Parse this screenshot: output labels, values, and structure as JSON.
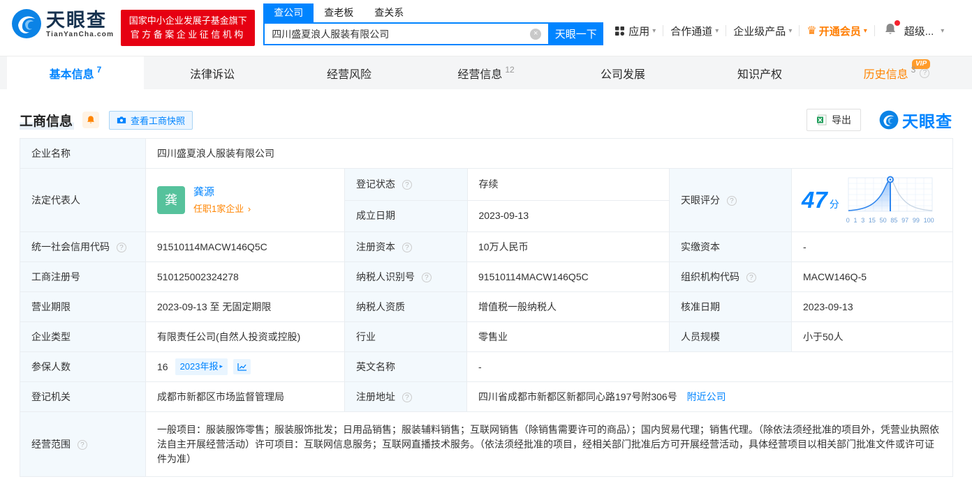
{
  "colors": {
    "primary_blue": "#0084ff",
    "orange": "#ff7d00",
    "status_green": "#2db14e",
    "avatar_green": "#56c29c",
    "badge_red": "#e60012"
  },
  "icons": {
    "help": "?",
    "clear": "×",
    "dropdown_arrow": "▾",
    "arrow_right": "›",
    "crown": "♛",
    "play": "▸"
  },
  "header": {
    "logo_text": "天眼查",
    "logo_domain": "TianYanCha.com",
    "badge_line1": "国家中小企业发展子基金旗下",
    "badge_line2": "官方备案企业征信机构",
    "search_tab_company": "查公司",
    "search_tab_boss": "查老板",
    "search_tab_relation": "查关系",
    "search_value": "四川盛夏浪人服装有限公司",
    "search_button": "天眼一下",
    "nav_apps": "应用",
    "nav_coop": "合作通道",
    "nav_enterprise": "企业级产品",
    "nav_vip": "开通会员",
    "nav_user": "超级..."
  },
  "tabs": {
    "basic": {
      "label": "基本信息",
      "count": "7"
    },
    "legal": {
      "label": "法律诉讼"
    },
    "risk": {
      "label": "经营风险"
    },
    "business": {
      "label": "经营信息",
      "count": "12"
    },
    "development": {
      "label": "公司发展"
    },
    "ip": {
      "label": "知识产权"
    },
    "history": {
      "label": "历史信息",
      "count": "3",
      "vip": "VIP"
    }
  },
  "section": {
    "title": "工商信息",
    "snapshot_button": "查看工商快照",
    "export_button": "导出",
    "brand": "天眼查"
  },
  "info": {
    "labels": {
      "company_name": "企业名称",
      "legal_rep": "法定代表人",
      "reg_status": "登记状态",
      "establish_date": "成立日期",
      "score": "天眼评分",
      "credit_code": "统一社会信用代码",
      "reg_capital": "注册资本",
      "paid_capital": "实缴资本",
      "reg_number": "工商注册号",
      "taxpayer_id": "纳税人识别号",
      "org_code": "组织机构代码",
      "business_term": "营业期限",
      "taxpayer_quality": "纳税人资质",
      "approval_date": "核准日期",
      "company_type": "企业类型",
      "industry": "行业",
      "staff_size": "人员规模",
      "insured_count": "参保人数",
      "english_name": "英文名称",
      "reg_authority": "登记机关",
      "reg_address": "注册地址",
      "business_scope": "经营范围"
    },
    "values": {
      "company_name": "四川盛夏浪人服装有限公司",
      "legal_rep_avatar": "龚",
      "legal_rep_name": "龚源",
      "legal_rep_positions": "任职1家企业",
      "reg_status": "存续",
      "establish_date": "2023-09-13",
      "score": "47",
      "score_unit": "分",
      "credit_code": "91510114MACW146Q5C",
      "reg_capital": "10万人民币",
      "paid_capital": "-",
      "reg_number": "510125002324278",
      "taxpayer_id": "91510114MACW146Q5C",
      "org_code": "MACW146Q-5",
      "business_term": "2023-09-13 至 无固定期限",
      "taxpayer_quality": "增值税一般纳税人",
      "approval_date": "2023-09-13",
      "company_type": "有限责任公司(自然人投资或控股)",
      "industry": "零售业",
      "staff_size": "小于50人",
      "insured_count": "16",
      "insured_badge": "2023年报",
      "english_name": "-",
      "reg_authority": "成都市新都区市场监督管理局",
      "reg_address": "四川省成都市新都区新都同心路197号附306号",
      "reg_address_link": "附近公司",
      "business_scope": "一般项目：服装服饰零售；服装服饰批发；日用品销售；服装辅料销售；互联网销售（除销售需要许可的商品）；国内贸易代理；销售代理。（除依法须经批准的项目外，凭营业执照依法自主开展经营活动）许可项目：互联网信息服务；互联网直播技术服务。（依法须经批准的项目，经相关部门批准后方可开展经营活动，具体经营项目以相关部门批准文件或许可证件为准）"
    }
  },
  "chart_data": {
    "type": "line",
    "title": "天眼评分",
    "score": 47,
    "score_max": 100,
    "x_ticks": [
      "0",
      "1",
      "3",
      "15",
      "50",
      "85",
      "97",
      "99",
      "100"
    ],
    "curve": "normal-distribution",
    "marker_at_score": 47,
    "legend_position": "none",
    "grid": true
  }
}
